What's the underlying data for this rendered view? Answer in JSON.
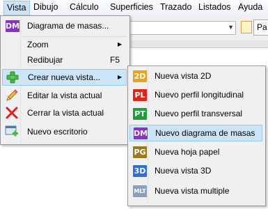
{
  "menubar": {
    "items": [
      "Vista",
      "Dibujo",
      "Cálculo",
      "Superficies",
      "Trazado",
      "Listados",
      "Ayuda"
    ]
  },
  "toolbar": {
    "button_label": "Pa"
  },
  "vista_menu": {
    "items": [
      {
        "label": "Diagrama de masas...",
        "icon": "DM",
        "color": "#8b2fc9"
      },
      {
        "label": "Zoom"
      },
      {
        "label": "Redibujar",
        "shortcut": "F5"
      },
      {
        "label": "Crear nueva vista..."
      },
      {
        "label": "Editar la vista actual"
      },
      {
        "label": "Cerrar la vista actual"
      },
      {
        "label": "Nuevo escritorio"
      }
    ]
  },
  "crear_submenu": {
    "items": [
      {
        "label": "Nueva vista 2D",
        "icon": "2D",
        "color": "#e8a21e"
      },
      {
        "label": "Nuevo perfil longitudinal",
        "icon": "PL",
        "color": "#e2231a"
      },
      {
        "label": "Nuevo perfil transversal",
        "icon": "PT",
        "color": "#1f9d3a"
      },
      {
        "label": "Nuevo diagrama de masas",
        "icon": "DM",
        "color": "#8b2fc9"
      },
      {
        "label": "Nueva hoja papel",
        "icon": "PG",
        "color": "#9a7a1c"
      },
      {
        "label": "Nueva vista 3D",
        "icon": "3D",
        "color": "#2f6fd6"
      },
      {
        "label": "Nueva vista multiple",
        "icon": "MLT",
        "color": "#8aa0b8"
      }
    ]
  }
}
